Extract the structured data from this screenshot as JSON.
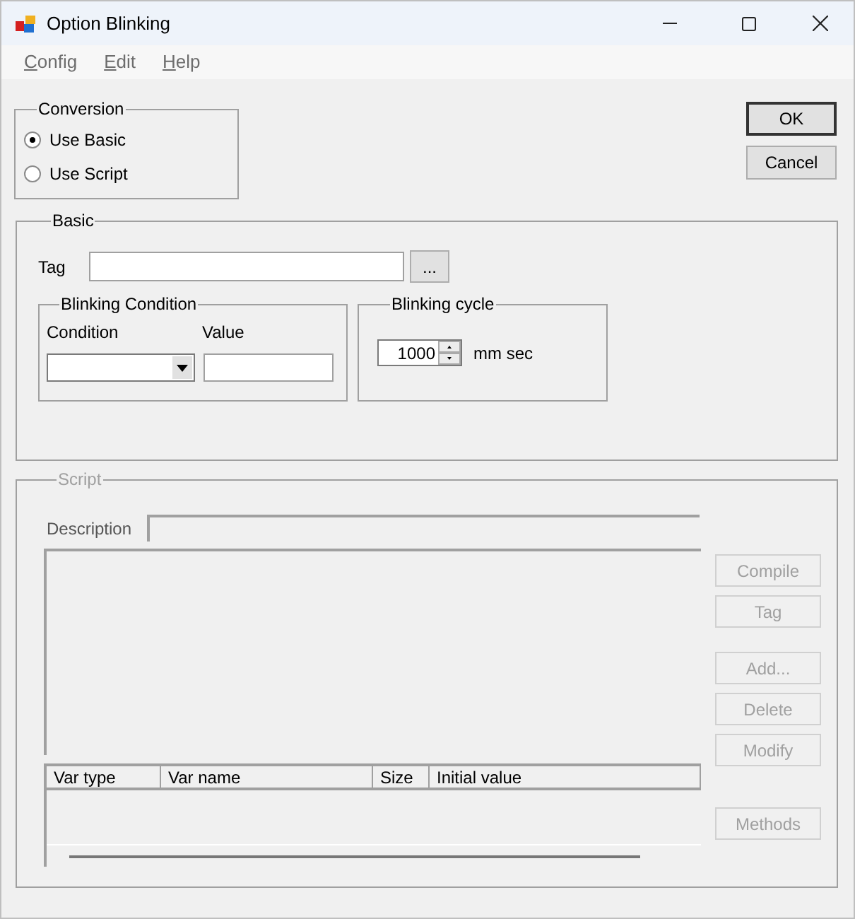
{
  "window": {
    "title": "Option Blinking"
  },
  "menu": [
    {
      "label": "Config"
    },
    {
      "label": "Edit"
    },
    {
      "label": "Help"
    }
  ],
  "conversion": {
    "title": "Conversion",
    "options": [
      {
        "label": "Use Basic",
        "selected": true
      },
      {
        "label": "Use Script",
        "selected": false
      }
    ]
  },
  "dialog_buttons": [
    {
      "label": "OK",
      "default": true
    },
    {
      "label": "Cancel",
      "default": false
    }
  ],
  "basic": {
    "title": "Basic",
    "tag_label": "Tag",
    "browse_button": "...",
    "condition_group": {
      "title": "Blinking Condition",
      "condition_label": "Condition",
      "value_label": "Value"
    },
    "cycle_group": {
      "title": "Blinking cycle",
      "value": "1000",
      "unit": "mm sec"
    }
  },
  "script": {
    "title": "Script",
    "disabled": true,
    "description_label": "Description",
    "columns": [
      "Var type",
      "Var name",
      "Size",
      "Initial value"
    ],
    "buttons": [
      {
        "label": "Compile"
      },
      {
        "label": "Tag"
      },
      {
        "label": "Add..."
      },
      {
        "label": "Delete"
      },
      {
        "label": "Modify"
      },
      {
        "label": "Methods"
      }
    ]
  }
}
